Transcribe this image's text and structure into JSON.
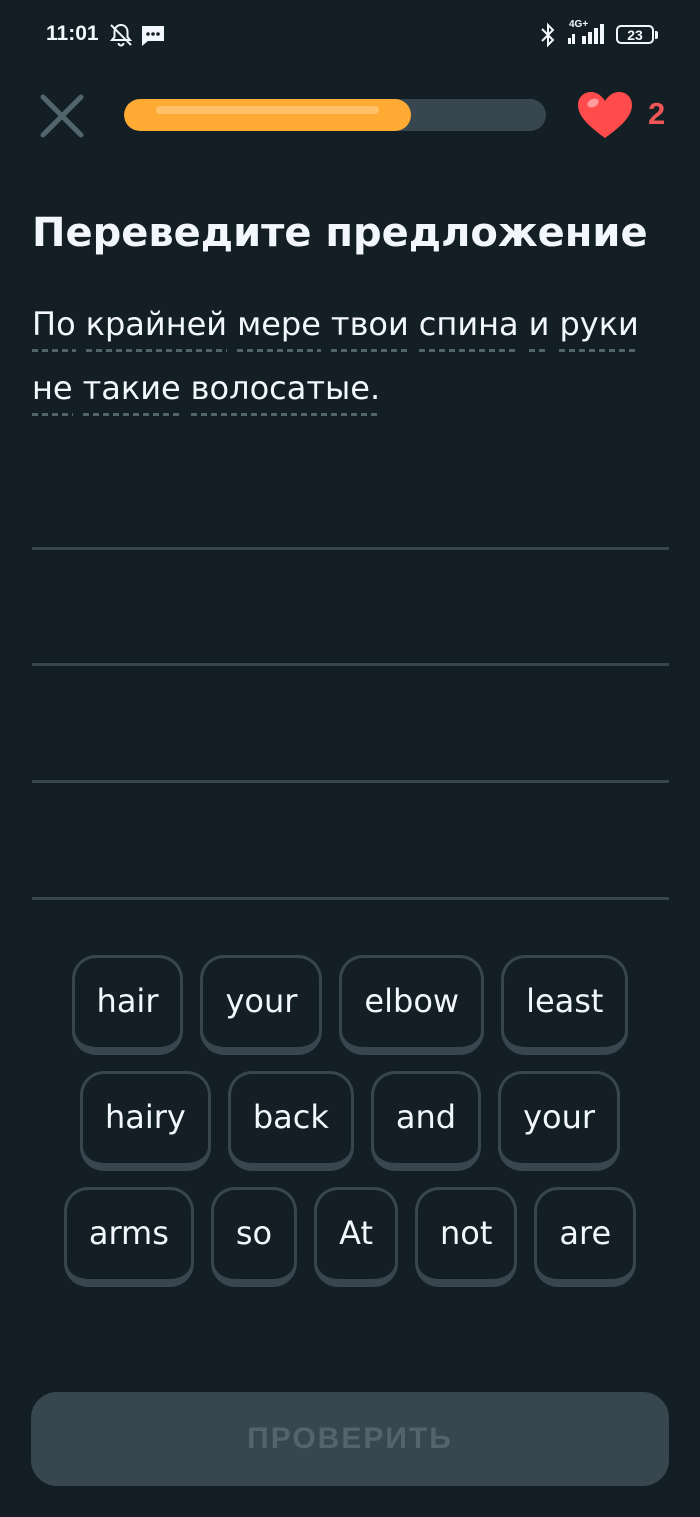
{
  "status_bar": {
    "time": "11:01",
    "network": "4G+",
    "battery": "23"
  },
  "header": {
    "progress": 0.68,
    "lives": "2",
    "accent_color": "#ffab33",
    "heart_color": "#ff4b4b"
  },
  "exercise": {
    "title": "Переведите предложение",
    "prompt_words": [
      "По",
      "крайней",
      "мере",
      "твои",
      "спина",
      "и",
      "руки",
      "не",
      "такие",
      "волосатые."
    ]
  },
  "word_bank": {
    "rows": [
      [
        "hair",
        "your",
        "elbow",
        "least"
      ],
      [
        "hairy",
        "back",
        "and",
        "your"
      ],
      [
        "arms",
        "so",
        "At",
        "not",
        "are"
      ]
    ]
  },
  "footer": {
    "check_label": "ПРОВЕРИТЬ"
  }
}
